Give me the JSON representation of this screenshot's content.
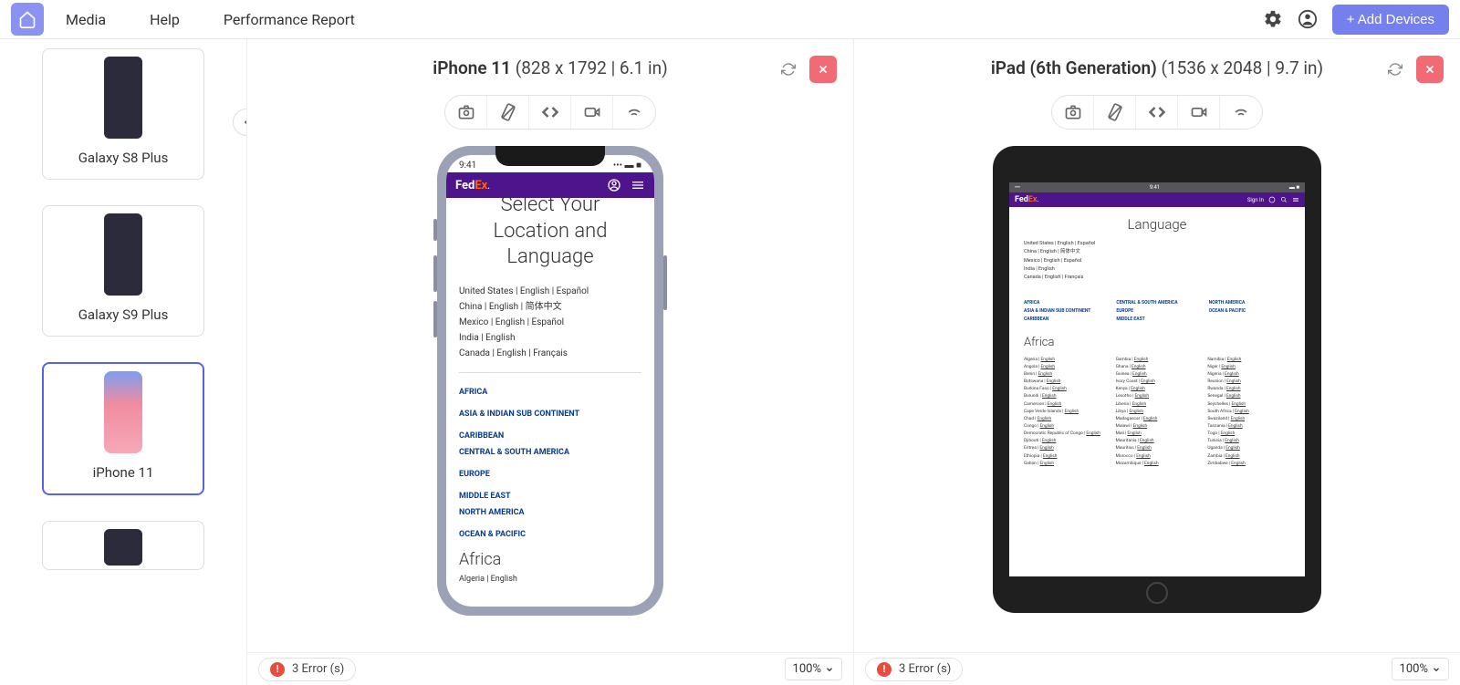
{
  "header": {
    "nav": [
      "Media",
      "Help",
      "Performance Report"
    ],
    "add_devices": "+ Add Devices"
  },
  "sidebar": {
    "devices": [
      {
        "label": "Galaxy S8 Plus",
        "selected": false
      },
      {
        "label": "Galaxy S9 Plus",
        "selected": false
      },
      {
        "label": "iPhone 11",
        "selected": true
      },
      {
        "label": "",
        "selected": false
      }
    ]
  },
  "panes": [
    {
      "device_name": "iPhone 11",
      "device_spec": "(828 x 1792 | 6.1 in)",
      "status_time": "9:41",
      "fedex": {
        "title_p1": "Select Your",
        "title_p2": "Location and",
        "title_p3": "Language",
        "locales": [
          "United States | English | Español",
          "China | English | 简体中文",
          "Mexico | English | Español",
          "India | English",
          "Canada | English | Français"
        ],
        "regions": [
          "AFRICA",
          "ASIA & INDIAN SUB CONTINENT",
          "CARIBBEAN",
          "CENTRAL & SOUTH AMERICA",
          "EUROPE",
          "MIDDLE EAST",
          "NORTH AMERICA",
          "OCEAN & PACIFIC"
        ],
        "africa_heading": "Africa",
        "africa_items": [
          "Algeria | English"
        ]
      },
      "errors": "3 Error (s)",
      "zoom": "100%"
    },
    {
      "device_name": "iPad (6th Generation)",
      "device_spec": "(1536 x 2048 | 9.7 in)",
      "status_time": "9:41",
      "fedex": {
        "signin": "Sign In",
        "title": "Language",
        "locales": [
          "United States | English | Español",
          "China | English | 简体中文",
          "Mexico | English | Español",
          "India | English",
          "Canada | English | Français"
        ],
        "regions_grid": [
          "AFRICA",
          "CENTRAL & SOUTH AMERICA",
          "NORTH AMERICA",
          "ASIA & INDIAN SUB CONTINENT",
          "EUROPE",
          "OCEAN & PACIFIC",
          "CARIBBEAN",
          "MIDDLE EAST",
          ""
        ],
        "africa_heading": "Africa",
        "africa_grid": [
          "Algeria | English",
          "Gambia | English",
          "Namibia | English",
          "Angola | English",
          "Ghana | English",
          "Niger | English",
          "Benin | English",
          "Guinea | English",
          "Nigeria | English",
          "Botswana | English",
          "Ivory Coast | English",
          "Reunion | English",
          "Burkina Faso | English",
          "Kenya | English",
          "Rwanda | English",
          "Burundi | English",
          "Lesotho | English",
          "Senegal | English",
          "Cameroon | English",
          "Liberia | English",
          "Seychelles | English",
          "Cape Verde Islands | English",
          "Libya | English",
          "South Africa | English",
          "Chad | English",
          "Madagascar | English",
          "Swaziland | English",
          "Congo | English",
          "Malawi | English",
          "Tanzania | English",
          "Democratic Republic of Congo | English",
          "Mali | English",
          "Togo | English",
          "Djibouti | English",
          "Mauritania | English",
          "Tunisia | English",
          "Eritrea | English",
          "Mauritius | English",
          "Uganda | English",
          "Ethiopia | English",
          "Morocco | English",
          "Zambia | English",
          "Gabon | English",
          "Mozambique | English",
          "Zimbabwe | English"
        ]
      },
      "errors": "3 Error (s)",
      "zoom": "100%"
    }
  ]
}
